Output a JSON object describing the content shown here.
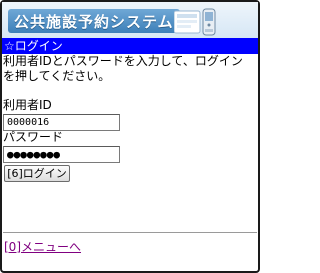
{
  "header": {
    "logo_text": "公共施設予約システム"
  },
  "page": {
    "heading": "☆ログイン",
    "instruction": "利用者IDとパスワードを入力して、ログイン\nを押してください。"
  },
  "form": {
    "user_id_label": "利用者ID",
    "user_id_value": "0000016",
    "password_label": "パスワード",
    "password_value": "●●●●●●●●",
    "login_button": "[6]ログイン"
  },
  "footer": {
    "menu_link": "[0]メニューへ"
  },
  "colors": {
    "heading_bar": "#0000ff",
    "visited_link": "#800080",
    "banner": "#d6e7f5"
  }
}
